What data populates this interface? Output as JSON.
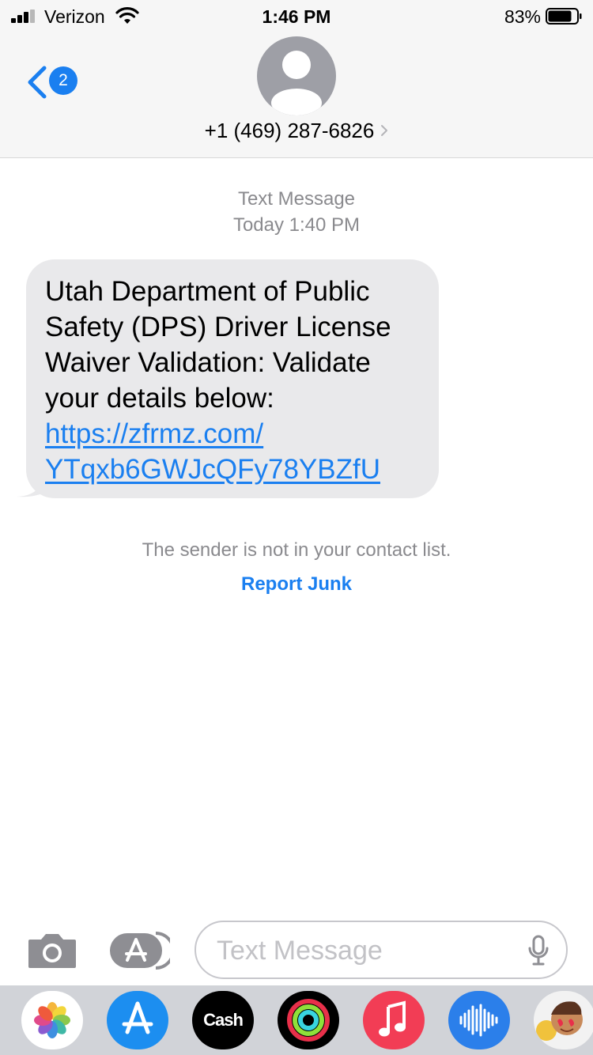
{
  "status_bar": {
    "carrier": "Verizon",
    "time": "1:46 PM",
    "battery_percent": "83%",
    "battery_level": 0.83,
    "signal_bars": 3,
    "signal_bars_total": 4
  },
  "header": {
    "back_badge_count": "2",
    "contact": "+1 (469) 287-6826"
  },
  "conversation": {
    "service_label": "Text Message",
    "timestamp": "Today 1:40 PM",
    "message_lines": [
      "Utah Department of Public",
      "Safety (DPS) Driver License",
      "Waiver Validation: Validate",
      "your details below:"
    ],
    "link_lines": [
      "https://zfrmz.com/",
      "YTqxb6GWJcQFy78YBZfU"
    ],
    "notice": "The sender is not in your contact list.",
    "report_junk": "Report Junk"
  },
  "input_bar": {
    "placeholder": "Text Message"
  },
  "app_drawer": {
    "apps": [
      {
        "name": "photos-icon"
      },
      {
        "name": "app-store-icon"
      },
      {
        "name": "apple-cash-icon",
        "label": "Cash"
      },
      {
        "name": "activity-icon"
      },
      {
        "name": "music-icon"
      },
      {
        "name": "audio-message-icon"
      },
      {
        "name": "memoji-icon"
      }
    ]
  },
  "colors": {
    "accent": "#1a7ff0",
    "bubble": "#e9e9eb",
    "secondary_text": "#8a8a8e",
    "bar_background": "#f6f6f6",
    "drawer_background": "#d1d3d8"
  }
}
